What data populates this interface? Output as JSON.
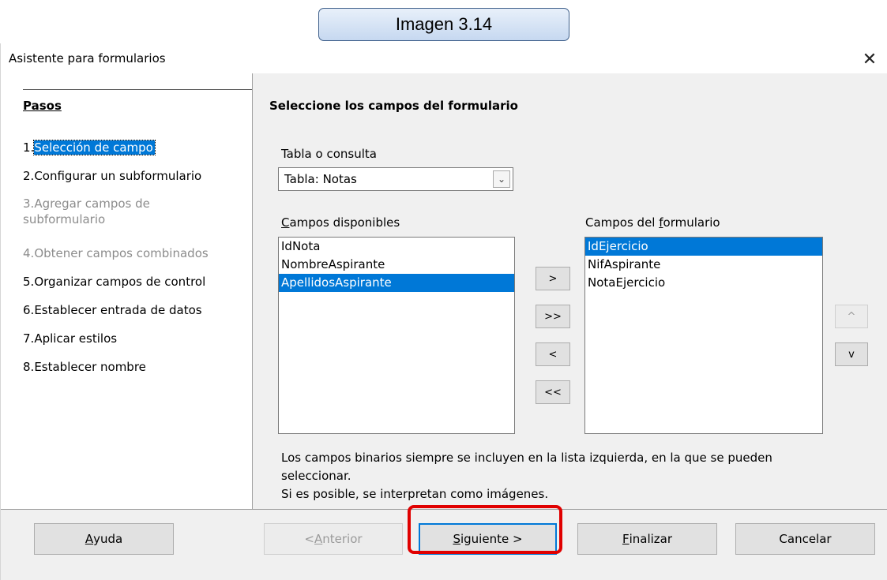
{
  "caption": "Imagen 3.14",
  "window": {
    "title": "Asistente para formularios",
    "close_glyph": "✕"
  },
  "steps": {
    "heading": "Pasos",
    "items": [
      {
        "num": "1.",
        "label": "Selección de campo",
        "state": "current"
      },
      {
        "num": "2.",
        "label": "Configurar un subformulario",
        "state": "enabled"
      },
      {
        "num": "3.",
        "label": "Agregar campos de",
        "label2": "subformulario",
        "state": "disabled"
      },
      {
        "num": "4.",
        "label": "Obtener campos combinados",
        "state": "disabled"
      },
      {
        "num": "5.",
        "label": "Organizar campos de control",
        "state": "enabled"
      },
      {
        "num": "6.",
        "label": "Establecer entrada de datos",
        "state": "enabled"
      },
      {
        "num": "7.",
        "label": "Aplicar estilos",
        "state": "enabled"
      },
      {
        "num": "8.",
        "label": "Establecer nombre",
        "state": "enabled"
      }
    ]
  },
  "content": {
    "title": "Seleccione los campos del formulario",
    "table_label": "Tabla o consulta",
    "table_value": "Tabla: Notas",
    "available_label_u": "C",
    "available_label_rest": "ampos disponibles",
    "available_fields": [
      "IdNota",
      "NombreAspirante",
      "ApellidosAspirante"
    ],
    "available_selected": 2,
    "form_label_a": "Campos del ",
    "form_label_u": "f",
    "form_label_b": "ormulario",
    "form_fields": [
      "IdEjercicio",
      "NifAspirante",
      "NotaEjercicio"
    ],
    "form_selected": 0,
    "move_buttons": [
      ">",
      ">>",
      "<",
      "<<"
    ],
    "order_buttons": [
      "^",
      "v"
    ],
    "info_lines": [
      "Los campos binarios siempre se incluyen en la lista izquierda, en la que se pueden",
      "seleccionar.",
      "Si es posible, se interpretan como imágenes."
    ]
  },
  "buttons": {
    "help_u": "A",
    "help_rest": "yuda",
    "back_pre": "< ",
    "back_u": "A",
    "back_rest": "nterior",
    "next_u": "S",
    "next_rest": "iguiente >",
    "finish_u": "F",
    "finish_rest": "inalizar",
    "cancel": "Cancelar"
  },
  "colors": {
    "selection": "#0078d7",
    "highlight_box": "#e00000",
    "disabled_text": "#8c8c8c"
  }
}
